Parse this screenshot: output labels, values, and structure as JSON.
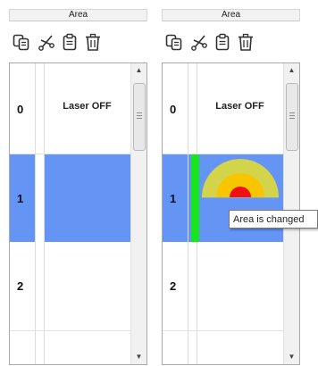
{
  "panels": {
    "left": {
      "header": "Area",
      "rows": [
        {
          "num": "0",
          "caption": "Laser OFF"
        },
        {
          "num": "1",
          "caption": ""
        },
        {
          "num": "2",
          "caption": ""
        }
      ]
    },
    "right": {
      "header": "Area",
      "rows": [
        {
          "num": "0",
          "caption": "Laser OFF"
        },
        {
          "num": "1",
          "caption": ""
        },
        {
          "num": "2",
          "caption": ""
        }
      ]
    }
  },
  "toolbar_icons": [
    "copy-icon",
    "cut-icon",
    "paste-icon",
    "delete-icon"
  ],
  "scrollbar": {
    "up_arrow": "▲",
    "down_arrow": "▼"
  },
  "tooltip": {
    "text": "Area is changed"
  },
  "colors": {
    "selection": "#6495f5",
    "changed_marker": "#16e51f",
    "laser_outer": "#d4d44a",
    "laser_middle": "#f7c600",
    "laser_core": "#f01010"
  }
}
